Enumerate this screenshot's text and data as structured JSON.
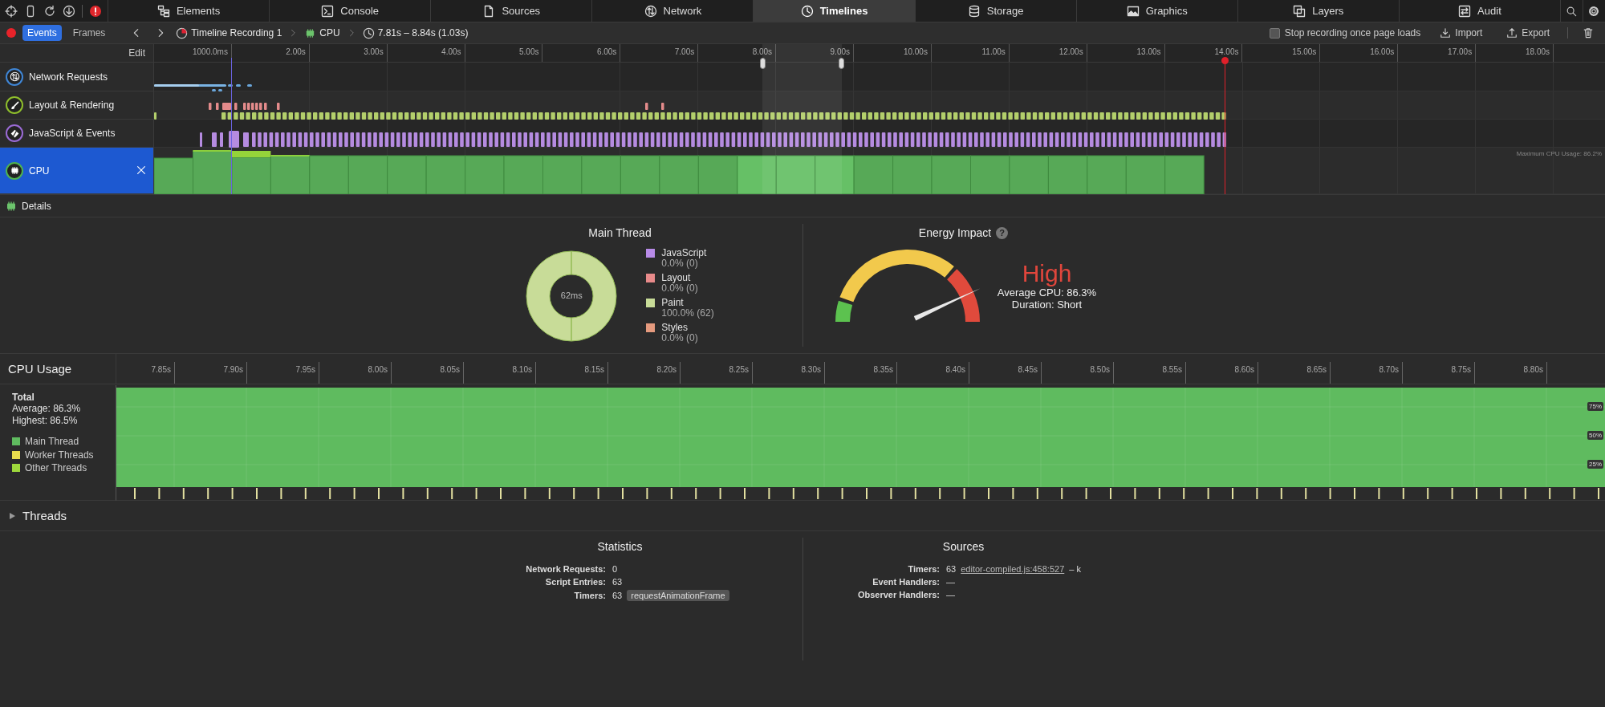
{
  "tabs": [
    {
      "label": "Elements",
      "selected": false
    },
    {
      "label": "Console",
      "selected": false
    },
    {
      "label": "Sources",
      "selected": false
    },
    {
      "label": "Network",
      "selected": false
    },
    {
      "label": "Timelines",
      "selected": true
    },
    {
      "label": "Storage",
      "selected": false
    },
    {
      "label": "Graphics",
      "selected": false
    },
    {
      "label": "Layers",
      "selected": false
    },
    {
      "label": "Audit",
      "selected": false
    }
  ],
  "view_modes": [
    {
      "label": "Events",
      "selected": true
    },
    {
      "label": "Frames",
      "selected": false
    }
  ],
  "breadcrumbs": [
    "Timeline Recording 1",
    "CPU",
    "7.81s – 8.84s (1.03s)"
  ],
  "stop_recording": {
    "label": "Stop recording once page loads",
    "checked": false
  },
  "actions": [
    "Import",
    "Export"
  ],
  "overview": {
    "edit_label": "Edit",
    "ruler_ticks": [
      "1000.0ms",
      "2.00s",
      "3.00s",
      "4.00s",
      "5.00s",
      "6.00s",
      "7.00s",
      "8.00s",
      "9.00s",
      "10.00s",
      "11.00s",
      "12.00s",
      "13.00s",
      "14.00s",
      "15.00s",
      "16.00s",
      "17.00s",
      "18.00s"
    ],
    "timelines": [
      {
        "label": "Network Requests",
        "kind": "network",
        "selected": false
      },
      {
        "label": "Layout & Rendering",
        "kind": "layout",
        "selected": false
      },
      {
        "label": "JavaScript & Events",
        "kind": "script",
        "selected": false
      },
      {
        "label": "CPU",
        "kind": "cpu",
        "selected": true
      }
    ],
    "max_cpu_label": "Maximum CPU Usage: 86.2%"
  },
  "details": {
    "label": "Details"
  },
  "main_thread": {
    "title": "Main Thread",
    "total": "62ms",
    "legend": [
      {
        "value": "0.0% (0)",
        "color": "#b88be8"
      },
      {
        "value": "0.0% (0)",
        "color": "#e88a8a"
      },
      {
        "value": "100.0% (62)",
        "color": "#c8dc98"
      },
      {
        "value": "0.0% (0)",
        "color": "#e59a7e"
      }
    ],
    "chart_data": {
      "type": "pie",
      "categories": [
        "JavaScript",
        "Layout",
        "Paint",
        "Styles"
      ],
      "values": [
        0,
        0,
        100,
        0
      ]
    }
  },
  "energy": {
    "title": "Energy Impact",
    "help": "?",
    "rating": "High",
    "average": "Average CPU: 86.3%",
    "duration": "Duration: Short",
    "level": 0.863
  },
  "cpu_usage": {
    "title": "CPU Usage",
    "total_label": "Total",
    "average": "Average: 86.3%",
    "highest": "Highest: 86.5%",
    "legend": [
      {
        "name": "Main Thread",
        "color": "#5fbb5f"
      },
      {
        "name": "Worker Threads",
        "color": "#e8dc4e"
      },
      {
        "name": "Other Threads",
        "color": "#9ed83c"
      }
    ],
    "x_axis_labels": [
      "7.85s",
      "7.90s",
      "7.95s",
      "8.00s",
      "8.05s",
      "8.10s",
      "8.15s",
      "8.20s",
      "8.25s",
      "8.30s",
      "8.35s",
      "8.40s",
      "8.45s",
      "8.50s",
      "8.55s",
      "8.60s",
      "8.65s",
      "8.70s",
      "8.75s",
      "8.80s"
    ],
    "y_axis_labels": [
      "75%",
      "50%",
      "25%"
    ]
  },
  "threads": {
    "label": "Threads",
    "expanded": false
  },
  "statistics": {
    "title": "Statistics",
    "rows": [
      {
        "label": "Network Requests:",
        "value": "0"
      },
      {
        "label": "Script Entries:",
        "value": "63"
      },
      {
        "label": "Timers:",
        "value": "63",
        "tag": "requestAnimationFrame"
      }
    ]
  },
  "sources": {
    "title": "Sources",
    "rows": [
      {
        "label": "Timers:",
        "value": "63",
        "link": "editor-compiled.js:458:527",
        "suffix": "– k"
      },
      {
        "label": "Event Handlers:",
        "value": "—"
      },
      {
        "label": "Observer Handlers:",
        "value": "—"
      }
    ]
  }
}
